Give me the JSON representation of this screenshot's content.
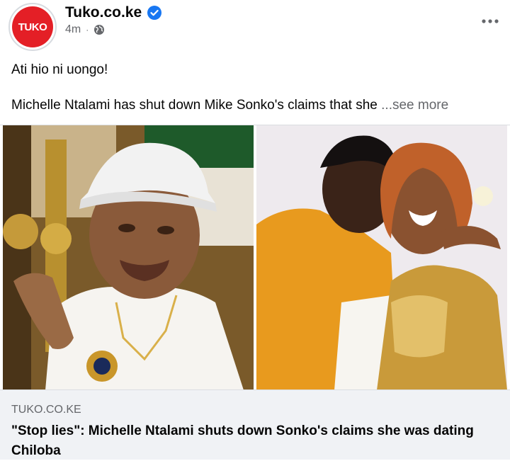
{
  "post": {
    "page_name": "Tuko.co.ke",
    "avatar_text": "TUKO",
    "time": "4m",
    "dot": "·",
    "text_line1": "Ati hio ni uongo!",
    "text_line2": "Michelle Ntalami has shut down Mike Sonko's claims that she ",
    "see_more": "...see more"
  },
  "link": {
    "domain": "TUKO.CO.KE",
    "title": "\"Stop lies\": Michelle Ntalami shuts down Sonko's claims she was dating Chiloba"
  },
  "colors": {
    "brand_red": "#e41f26",
    "verified_blue": "#1877f2",
    "secondary_text": "#65676b",
    "preview_bg": "#f0f2f5"
  },
  "icons": {
    "verified": "verified-badge-icon",
    "audience": "globe-icon",
    "more": "more-options-icon"
  }
}
